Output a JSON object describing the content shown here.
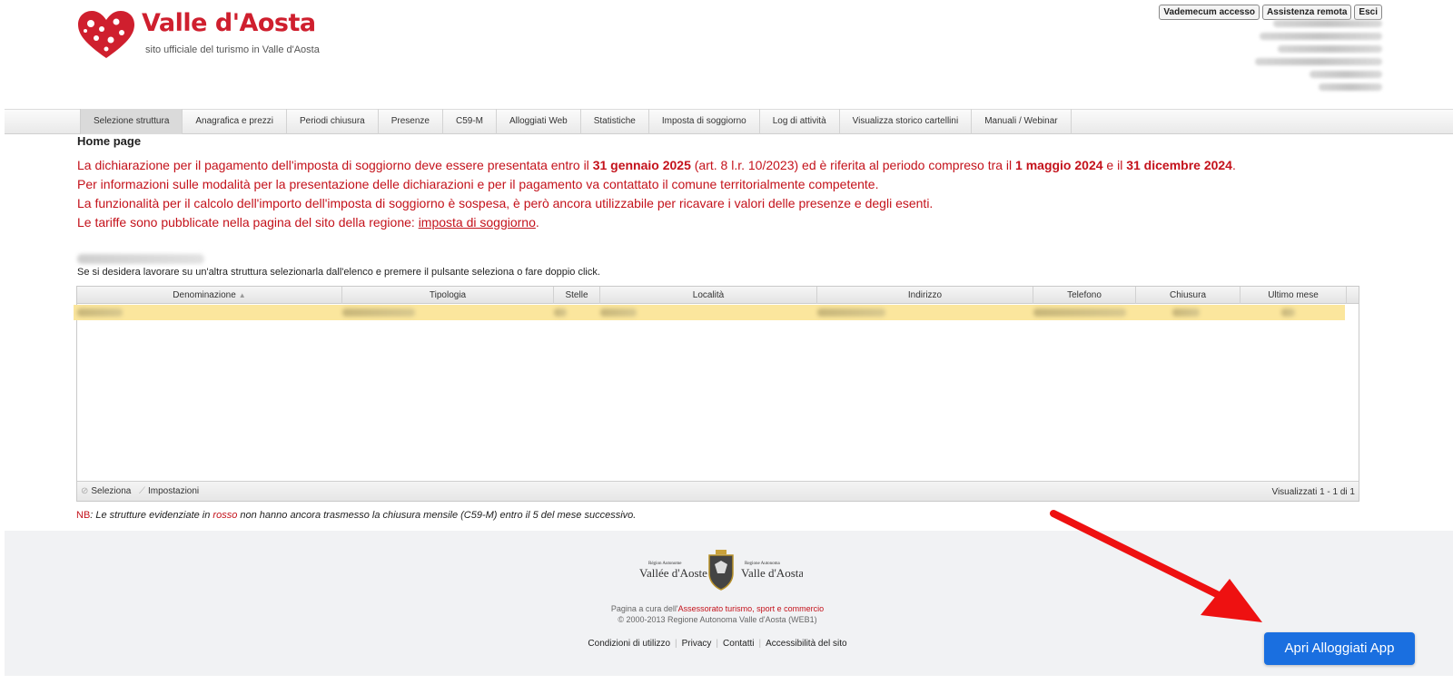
{
  "header": {
    "brand_title": "Valle d'Aosta",
    "brand_subtitle": "sito ufficiale del turismo in Valle d'Aosta",
    "top_buttons": [
      "Vademecum accesso",
      "Assistenza remota",
      "Esci"
    ]
  },
  "menu": {
    "items": [
      "Selezione struttura",
      "Anagrafica e prezzi",
      "Periodi chiusura",
      "Presenze",
      "C59-M",
      "Alloggiati Web",
      "Statistiche",
      "Imposta di soggiorno",
      "Log di attività",
      "Visualizza storico cartellini",
      "Manuali / Webinar"
    ],
    "active_index": 0
  },
  "page": {
    "title": "Home page",
    "notice": {
      "l1_a": "La dichiarazione per il pagamento dell'imposta di soggiorno deve essere presentata entro il ",
      "l1_b": "31 gennaio 2025",
      "l1_c": " (art. 8 l.r. 10/2023) ed è riferita al periodo compreso tra il ",
      "l1_d": "1 maggio 2024",
      "l1_e": " e il ",
      "l1_f": "31 dicembre 2024",
      "l1_g": ".",
      "l2": "Per informazioni sulle modalità per la presentazione delle dichiarazioni e per il pagamento va contattato il comune territorialmente competente.",
      "l3": "La funzionalità per il calcolo dell'importo dell'imposta di soggiorno è sospesa, è però ancora utilizzabile per ricavare i valori delle presenze e degli esenti.",
      "l4_a": "Le tariffe sono pubblicate nella pagina del sito della regione: ",
      "l4_link": "imposta di soggiorno",
      "l4_b": "."
    },
    "instruction": "Se si desidera lavorare su un'altra struttura selezionarla dall'elenco e premere il pulsante seleziona o fare doppio click."
  },
  "grid": {
    "columns": [
      "Denominazione",
      "Tipologia",
      "Stelle",
      "Località",
      "Indirizzo",
      "Telefono",
      "Chiusura",
      "Ultimo mese"
    ],
    "footer_select": "Seleziona",
    "footer_settings": "Impostazioni",
    "footer_count": "Visualizzati 1 - 1 di 1"
  },
  "nb": {
    "label": "NB",
    "text_a": ": Le strutture evidenziate in ",
    "text_red": "rosso",
    "text_b": " non hanno ancora trasmesso la chiusura mensile (C59-M) entro il 5 del mese successivo."
  },
  "footer": {
    "logo_left_small": "Région Autonome",
    "logo_left_big": "Vallée d'Aoste",
    "logo_right_small": "Regione Autonoma",
    "logo_right_big": "Valle d'Aosta",
    "credit_a": "Pagina a cura dell'",
    "credit_link": "Assessorato turismo, sport e commercio",
    "copyright": "© 2000-2013 Regione Autonoma Valle d'Aosta (WEB1)",
    "links": [
      "Condizioni di utilizzo",
      "Privacy",
      "Contatti",
      "Accessibilità del sito"
    ]
  },
  "cta": {
    "label": "Apri Alloggiati App"
  },
  "colors": {
    "brand_red": "#cf1f2e",
    "notice_red": "#c4121b",
    "row_highlight": "#fbe69d",
    "cta_blue": "#1a6fe0",
    "arrow_red": "#ee1111"
  }
}
